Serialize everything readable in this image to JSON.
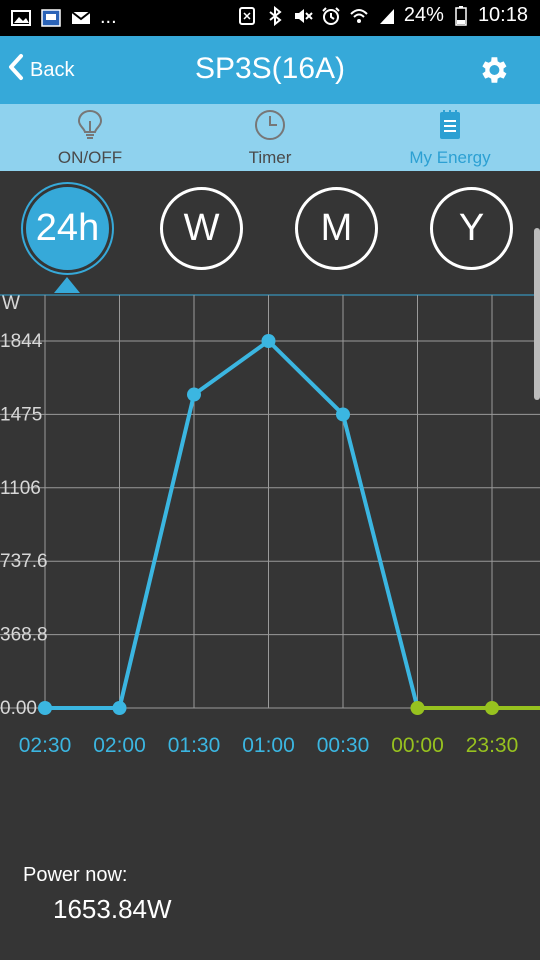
{
  "status_bar": {
    "icons_left": [
      "gallery-icon",
      "app-icon",
      "mail-icon"
    ],
    "more": "...",
    "icons_right": [
      "nfc-icon",
      "bluetooth-icon",
      "mute-icon",
      "alarm-icon",
      "wifi-icon",
      "signal-icon"
    ],
    "battery": "24%",
    "time": "10:18"
  },
  "header": {
    "back_label": "Back",
    "title": "SP3S(16A)",
    "background": "#36a9d9"
  },
  "tabs": [
    {
      "label": "ON/OFF",
      "icon": "bulb-icon",
      "active": false
    },
    {
      "label": "Timer",
      "icon": "clock-icon",
      "active": false
    },
    {
      "label": "My Energy",
      "icon": "notepad-icon",
      "active": true
    }
  ],
  "periods": [
    {
      "label": "24h",
      "active": true
    },
    {
      "label": "W",
      "active": false
    },
    {
      "label": "M",
      "active": false
    },
    {
      "label": "Y",
      "active": false
    }
  ],
  "chart_data": {
    "type": "line",
    "ylabel": "W",
    "yticks": [
      "0.00",
      "368.8",
      "737.6",
      "1106",
      "1475",
      "1844"
    ],
    "ylim": [
      0,
      1844
    ],
    "categories": [
      "02:30",
      "02:00",
      "01:30",
      "01:00",
      "00:30",
      "00:00",
      "23:30"
    ],
    "values": [
      0,
      0,
      1575,
      1844,
      1475,
      0,
      0
    ],
    "extra_right": 0,
    "colors": {
      "today": "#3bb6e1",
      "yesterday": "#97c21f",
      "grid": "#9a9a9a"
    },
    "today_count": 5,
    "grid": true
  },
  "power": {
    "label": "Power now:",
    "value": "1653.84W"
  }
}
